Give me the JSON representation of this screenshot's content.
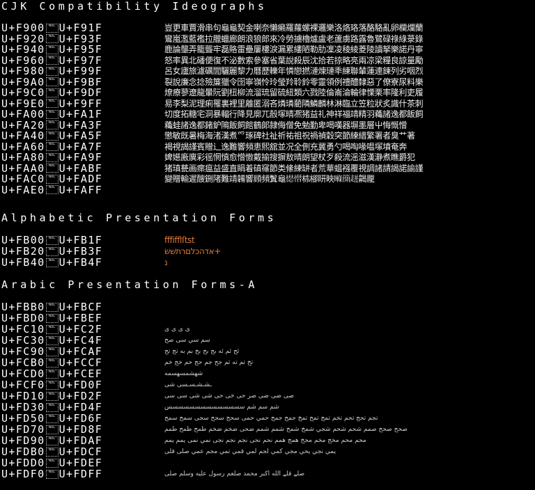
{
  "sections": [
    {
      "title": "CJK Compatibility Ideographs"
    },
    {
      "title": "Alphabetic Presentation Forms"
    },
    {
      "title": "Arabic Presentation Forms-A"
    }
  ],
  "nul_label": "NUL",
  "cjk_rows": [
    {
      "start": "U+F900",
      "end": "U+F91F",
      "glyphs": "豈更車賈滑串句龜龜契金喇奈懶癩羅蘿螺裸邏樂洛烙珞落酪駱亂卵欄爛蘭"
    },
    {
      "start": "U+F920",
      "end": "U+F93F",
      "glyphs": "鸞嵐濫藍襤拉臘蠟廊朗浪狼郎來冷勞擄櫓爐盧老蘆虜路露魯鷺碌祿綠菉錄"
    },
    {
      "start": "U+F940",
      "end": "U+F95F",
      "glyphs": "鹿論壟弄籠聾牢磊賂雷壘屢樓淚漏累縷陋勒肋凜凌稜綾菱陵讀拏樂諾丹寧"
    },
    {
      "start": "U+F960",
      "end": "U+F97F",
      "glyphs": "怒率異北磻便復不泌數索參塞省葉說殺辰沈拾若掠略亮兩凉梁糧良諒量勵"
    },
    {
      "start": "U+F980",
      "end": "U+F99F",
      "glyphs": "呂女廬旅濾礪閭驪麗黎力曆歷轢年憐戀撚漣煉璉秊練聯輦蓮連鍊列劣咽烈"
    },
    {
      "start": "U+F9A0",
      "end": "U+F9BF",
      "glyphs": "裂說廉念捻殮簾獵令囹寧嶺怜玲瑩羚聆鈴零靈領例禮醴隸惡了僚寮尿料樂"
    },
    {
      "start": "U+F9C0",
      "end": "U+F9DF",
      "glyphs": "燎療蓼遼龍暈阮劉杻柳流溜琉留硫紐類六戮陸倫崙淪輪律慄栗率隆利吏履"
    },
    {
      "start": "U+F9E0",
      "end": "U+F9FF",
      "glyphs": "易李梨泥理痢罹裏裡里離匿溺吝燐璘藺隣鱗麟林淋臨立笠粒狀炙識什茶刺"
    },
    {
      "start": "U+FA00",
      "end": "U+FA1F",
      "glyphs": "切度拓糖宅洞暴輻行降見廓兀嗀塚晴凞猪益礼神祥福靖精羽蘒諸逸都飯飼"
    },
    {
      "start": "U+FA20",
      "end": "U+FA3F",
      "glyphs": "蘒蛙諸逸都鍺鈩隝飯飼館鶴郞隷侮僧免勉勤卑喝嘆器塀墨層屮悔慨憎"
    },
    {
      "start": "U+FA40",
      "end": "U+FA5F",
      "glyphs": "懲敏既暑梅海渚漢煮爫琢碑社祉祈祐祖祝禍禎穀突節練縉繁署者臭艹著"
    },
    {
      "start": "U+FA60",
      "end": "U+FA7F",
      "glyphs": "褐視謁謹賓贈辶逸難響頻恵𤋮舘並况全侀充冀勇勺喝啕喙嗢塚墳奄奔"
    },
    {
      "start": "U+FA80",
      "end": "U+FA9F",
      "glyphs": "婢嬨廒廙彩徭惘慎愈憎慠戴揄搜摒敖晴朗望杖歹殺流滛滋漢瀞煮瞧爵犯"
    },
    {
      "start": "U+FAA0",
      "end": "U+FABF",
      "glyphs": "猪瑱甆画瘝瘟益盛直睊着磌窱節类絛練缾者荒華蝹襁覆視調諸請謁諾諭謹"
    },
    {
      "start": "U+FAC0",
      "end": "U+FADF",
      "glyphs": "變贈輸遲醙鉶陼難靖韛響頋頻鬒龜𢡊𢡄𣏕㮝䀘䀹𥉉𥳐𧻓齃龎"
    },
    {
      "start": "U+FAE0",
      "end": "U+FAFF",
      "glyphs": ""
    }
  ],
  "alpha_rows": [
    {
      "start": "U+FB00",
      "end": "U+FB1F",
      "glyphs": "fffifflſtst"
    },
    {
      "start": "U+FB20",
      "end": "U+FB3F",
      "glyphs": "אדהכלםרתשׁשׂ+"
    },
    {
      "start": "U+FB40",
      "end": "U+FB4F",
      "glyphs": "נ"
    }
  ],
  "arabic_rows": [
    {
      "start": "U+FBB0",
      "end": "U+FBCF",
      "glyphs": ""
    },
    {
      "start": "U+FBD0",
      "end": "U+FBEF",
      "glyphs": ""
    },
    {
      "start": "U+FC10",
      "end": "U+FC2F",
      "glyphs": "ی ی ى ى"
    },
    {
      "start": "U+FC30",
      "end": "U+FC4F",
      "glyphs": "سم سي سی صح"
    },
    {
      "start": "U+FC90",
      "end": "U+FCAF",
      "glyphs": "ئح ئم ئه بج بح بخ بم به تج تح"
    },
    {
      "start": "U+FCB0",
      "end": "U+FCCF",
      "glyphs": "تخ تم ته ثم جح جم حج حم خج خم"
    },
    {
      "start": "U+FCD0",
      "end": "U+FCEF",
      "glyphs": "شهشمسهسمه"
    },
    {
      "start": "U+FCF0",
      "end": "U+FD0F",
      "glyphs": "ـشـشـسـسی شی"
    },
    {
      "start": "U+FD10",
      "end": "U+FD2F",
      "glyphs": "صی ضی ضی صر حی خی حی شی شی سی سی"
    },
    {
      "start": "U+FD30",
      "end": "U+FD4F",
      "glyphs": "شم سم شم سسسسسسسسسسسسسس"
    },
    {
      "start": "U+FD50",
      "end": "U+FD6F",
      "glyphs": "تجم تحج تحم تخم تمج تمح تمخ جمح جمح حمي حمى سحج سجح سجى سمح سمج"
    },
    {
      "start": "U+FD70",
      "end": "U+FD8F",
      "glyphs": "صحح صحح صمم شحم شحم شجي شمخ شمخ شمم شمم ضحى ضخم ضخم طمح طمح طمم"
    },
    {
      "start": "U+FD90",
      "end": "U+FDAF",
      "glyphs": "محم محم مخج مخم مجخ همج همم نحم نحى نجم نجم نجى نمي نمى يمم يمم"
    },
    {
      "start": "U+FDB0",
      "end": "U+FDCF",
      "glyphs": "يمي نجي يحي مجي كمي لجم لمي قمي تمي مجم عمي صلى قلى"
    },
    {
      "start": "U+FDD0",
      "end": "U+FDEF",
      "glyphs": ""
    },
    {
      "start": "U+FDF0",
      "end": "U+FDFF",
      "glyphs": "صلے قلے الله اكبر محمد صلعم رسول عليه وسلم صلى"
    }
  ]
}
